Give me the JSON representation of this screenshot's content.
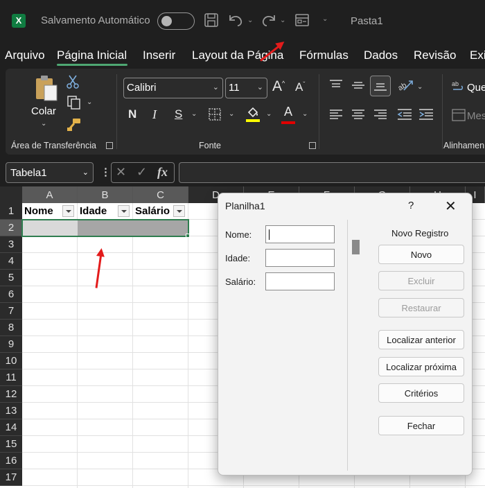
{
  "titlebar": {
    "autosave_label": "Salvamento Automático",
    "document_name": "Pasta1"
  },
  "tabs": [
    "Arquivo",
    "Página Inicial",
    "Inserir",
    "Layout da Página",
    "Fórmulas",
    "Dados",
    "Revisão",
    "Exi"
  ],
  "ribbon": {
    "clipboard": {
      "paste_label": "Colar",
      "group_label": "Área de Transferência"
    },
    "font": {
      "font_name": "Calibri",
      "font_size": "11",
      "group_label": "Fonte",
      "bold": "N",
      "italic": "I",
      "underline": "S",
      "font_color_glyph": "A",
      "grow_glyph": "A",
      "shrink_glyph": "A",
      "highlight_color": "#ffff00",
      "font_color": "#e00000"
    },
    "alignment": {
      "group_label": "Alinhamen",
      "wrap_label": "Que",
      "merge_label": "Mes"
    }
  },
  "formula_bar": {
    "name_box": "Tabela1",
    "fx_label": "fx",
    "cancel_glyph": "✕",
    "enter_glyph": "✓",
    "value": ""
  },
  "grid": {
    "columns": [
      "A",
      "B",
      "C",
      "D",
      "E",
      "F",
      "G",
      "H",
      "I"
    ],
    "rows": [
      "1",
      "2",
      "3",
      "4",
      "5",
      "6",
      "7",
      "8",
      "9",
      "10",
      "11",
      "12",
      "13",
      "14",
      "15",
      "16",
      "17"
    ],
    "table_headers": [
      "Nome",
      "Idade",
      "Salário"
    ]
  },
  "dialog": {
    "title": "Planilha1",
    "help": "?",
    "close": "✕",
    "fields": [
      {
        "label": "Nome:",
        "value": ""
      },
      {
        "label": "Idade:",
        "value": ""
      },
      {
        "label": "Salário:",
        "value": ""
      }
    ],
    "record_status": "Novo Registro",
    "buttons": {
      "new": "Novo",
      "delete": "Excluir",
      "restore": "Restaurar",
      "find_prev": "Localizar anterior",
      "find_next": "Localizar próxima",
      "criteria": "Critérios",
      "close": "Fechar"
    }
  },
  "colors": {
    "accent_green": "#4ea772",
    "excel_green": "#107c41",
    "arrow_red": "#e31b1b"
  }
}
